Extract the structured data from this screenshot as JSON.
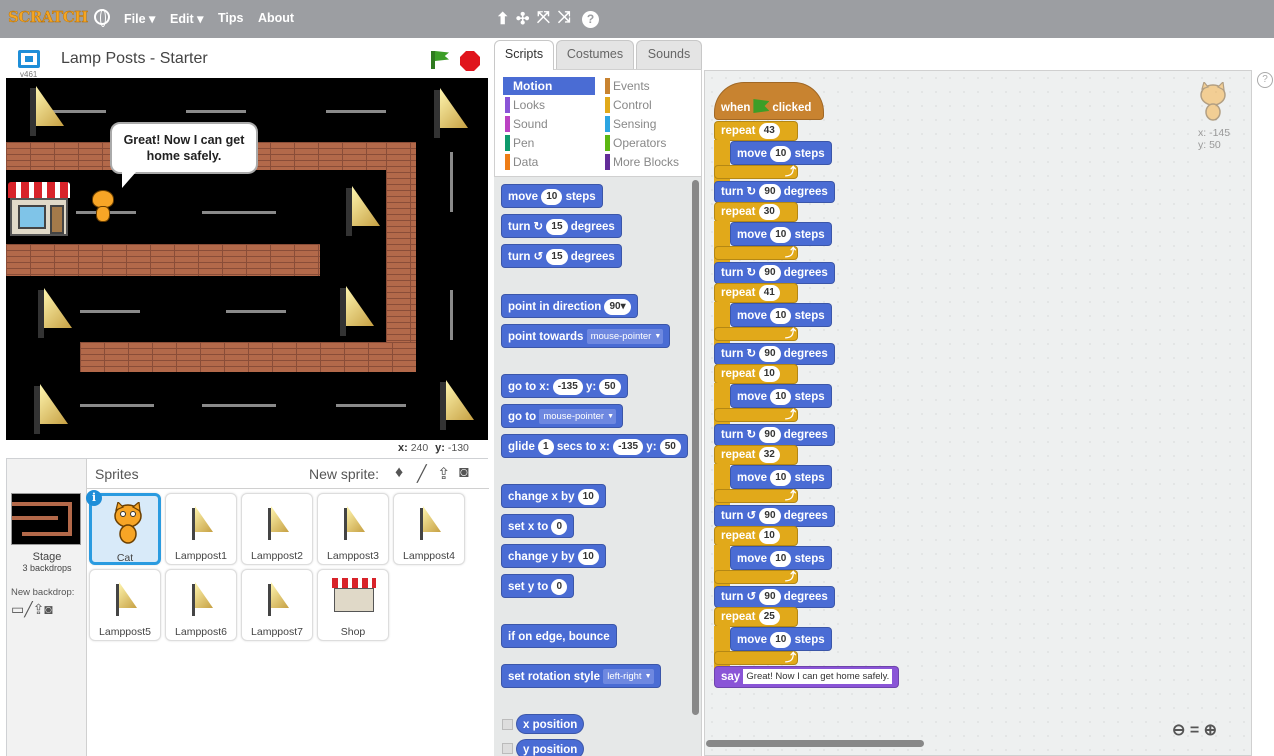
{
  "menubar": {
    "logo": "SCRATCH",
    "file": "File ▾",
    "edit": "Edit ▾",
    "tips": "Tips",
    "about": "About",
    "tools": [
      "⬆",
      "✣",
      "⤧",
      "⤨",
      "?"
    ]
  },
  "stage": {
    "title": "Lamp Posts - Starter",
    "version": "v461",
    "speech": "Great! Now I can get home safely.",
    "coords_x_label": "x:",
    "coords_x": "240",
    "coords_y_label": "y:",
    "coords_y": "-130"
  },
  "sprites": {
    "title": "Sprites",
    "new_sprite": "New sprite:",
    "stage_label": "Stage",
    "backdrops": "3 backdrops",
    "new_backdrop": "New backdrop:",
    "items": [
      "Cat",
      "Lamppost1",
      "Lamppost2",
      "Lamppost3",
      "Lamppost4",
      "Lamppost5",
      "Lamppost6",
      "Lamppost7",
      "Shop"
    ]
  },
  "tabs": [
    "Scripts",
    "Costumes",
    "Sounds"
  ],
  "categories": {
    "motion": "Motion",
    "looks": "Looks",
    "sound": "Sound",
    "pen": "Pen",
    "data": "Data",
    "events": "Events",
    "control": "Control",
    "sensing": "Sensing",
    "operators": "Operators",
    "more": "More Blocks"
  },
  "colors": {
    "motion": "#4a6cd4",
    "looks": "#8a55d7",
    "sound": "#bb42c3",
    "pen": "#0e9a6c",
    "data": "#ee7d16",
    "events": "#c88330",
    "control": "#e1a91a",
    "sensing": "#2ca5e2",
    "operators": "#5cb712",
    "more": "#632d99"
  },
  "palette": {
    "move": "move",
    "steps": "steps",
    "move_val": "10",
    "turn": "turn",
    "degrees": "degrees",
    "turn_val": "15",
    "point_dir": "point in direction",
    "point_dir_val": "90▾",
    "point_towards": "point towards",
    "mouse_pointer": "mouse-pointer",
    "goto": "go to x:",
    "goto_x": "-135",
    "y_label": "y:",
    "goto_y": "50",
    "goto2": "go to",
    "glide": "glide",
    "glide_secs": "1",
    "glide_mid": "secs to x:",
    "glide_x": "-135",
    "glide_y": "50",
    "change_x": "change x by",
    "change_x_val": "10",
    "set_x": "set x to",
    "set_x_val": "0",
    "change_y": "change y by",
    "change_y_val": "10",
    "set_y": "set y to",
    "set_y_val": "0",
    "bounce": "if on edge, bounce",
    "rot_style": "set rotation style",
    "rot_val": "left-right",
    "xpos": "x position",
    "ypos": "y position"
  },
  "script": {
    "when": "when",
    "clicked": "clicked",
    "repeat": "repeat",
    "move": "move",
    "steps": "steps",
    "turn": "turn",
    "degrees": "degrees",
    "say": "say",
    "say_text": "Great! Now I can get home safely.",
    "repeats": [
      "43",
      "30",
      "41",
      "10",
      "32",
      "10",
      "25"
    ],
    "move_val": "10",
    "turn_val": "90",
    "sprite_x": "x: -145",
    "sprite_y": "y: 50"
  },
  "zoom": {
    "out": "🔍−",
    "reset": "=",
    "in": "🔍+"
  }
}
